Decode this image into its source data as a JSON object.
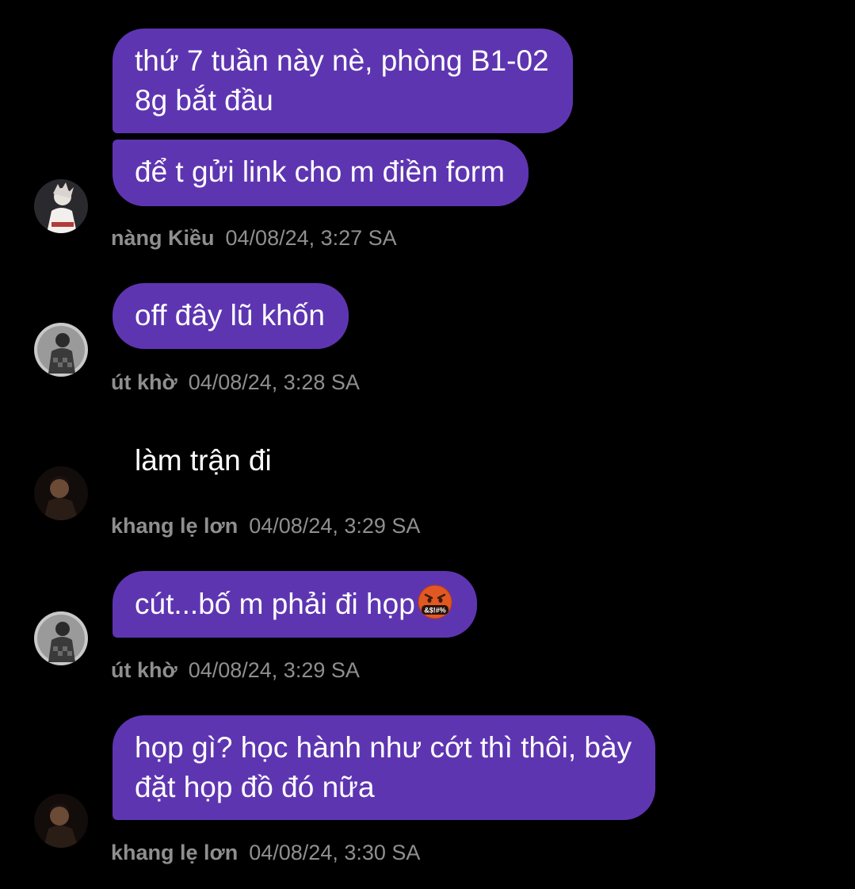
{
  "messages": [
    {
      "text": "thứ 7 tuần này nè, phòng B1-02\n8g bắt đầu"
    },
    {
      "text": "để t gửi link cho m điền form"
    },
    {
      "text": "off đây lũ khốn"
    },
    {
      "text": "làm trận đi"
    },
    {
      "text": "cút...bố m phải đi họp"
    },
    {
      "text": "họp gì? học hành như cớt thì thôi, bày\nđặt họp đồ đó nữa"
    }
  ],
  "senders": [
    {
      "name": "nàng Kiều",
      "time": "04/08/24, 3:27 SA"
    },
    {
      "name": "út khờ",
      "time": "04/08/24, 3:28 SA"
    },
    {
      "name": "khang lẹ lơn",
      "time": "04/08/24, 3:29 SA"
    },
    {
      "name": "út khờ",
      "time": "04/08/24, 3:29 SA"
    },
    {
      "name": "khang lẹ lơn",
      "time": "04/08/24, 3:30 SA"
    }
  ],
  "emoji": {
    "name": "face-with-symbols-on-mouth",
    "symbols": "&$!#%"
  },
  "colors": {
    "bubble": "#5e35b1",
    "background": "#000000",
    "meta_text": "#8f8f8f",
    "message_text": "#ffffff"
  }
}
